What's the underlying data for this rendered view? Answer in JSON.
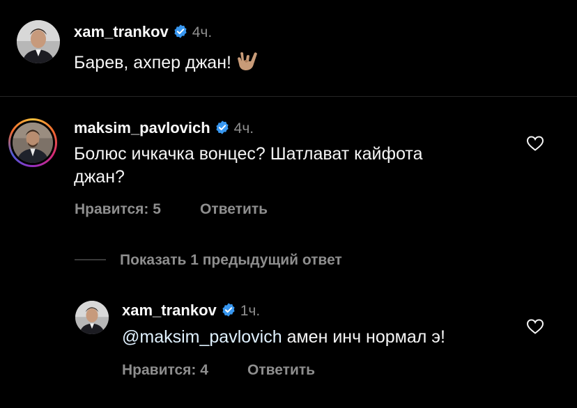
{
  "comments": [
    {
      "username": "xam_trankov",
      "time": "4ч.",
      "text": "Барев, ахпер джан!",
      "emoji_icon": "sign-of-horns-emoji"
    },
    {
      "username": "maksim_pavlovich",
      "time": "4ч.",
      "text_line1": "Болюс ичкачка вонцес? Шатлават кайфота",
      "text_line2": "джан?",
      "likes": "Нравится: 5",
      "reply": "Ответить"
    }
  ],
  "show_replies": "Показать 1 предыдущий ответ",
  "reply_comment": {
    "username": "xam_trankov",
    "time": "1ч.",
    "mention": "@maksim_pavlovich",
    "text": " амен инч нормал э!",
    "likes": "Нравится: 4",
    "reply": "Ответить"
  },
  "colors": {
    "background": "#000000",
    "muted": "#8e8e8e",
    "verified": "#3897f0",
    "mention": "#e0f1ff"
  }
}
